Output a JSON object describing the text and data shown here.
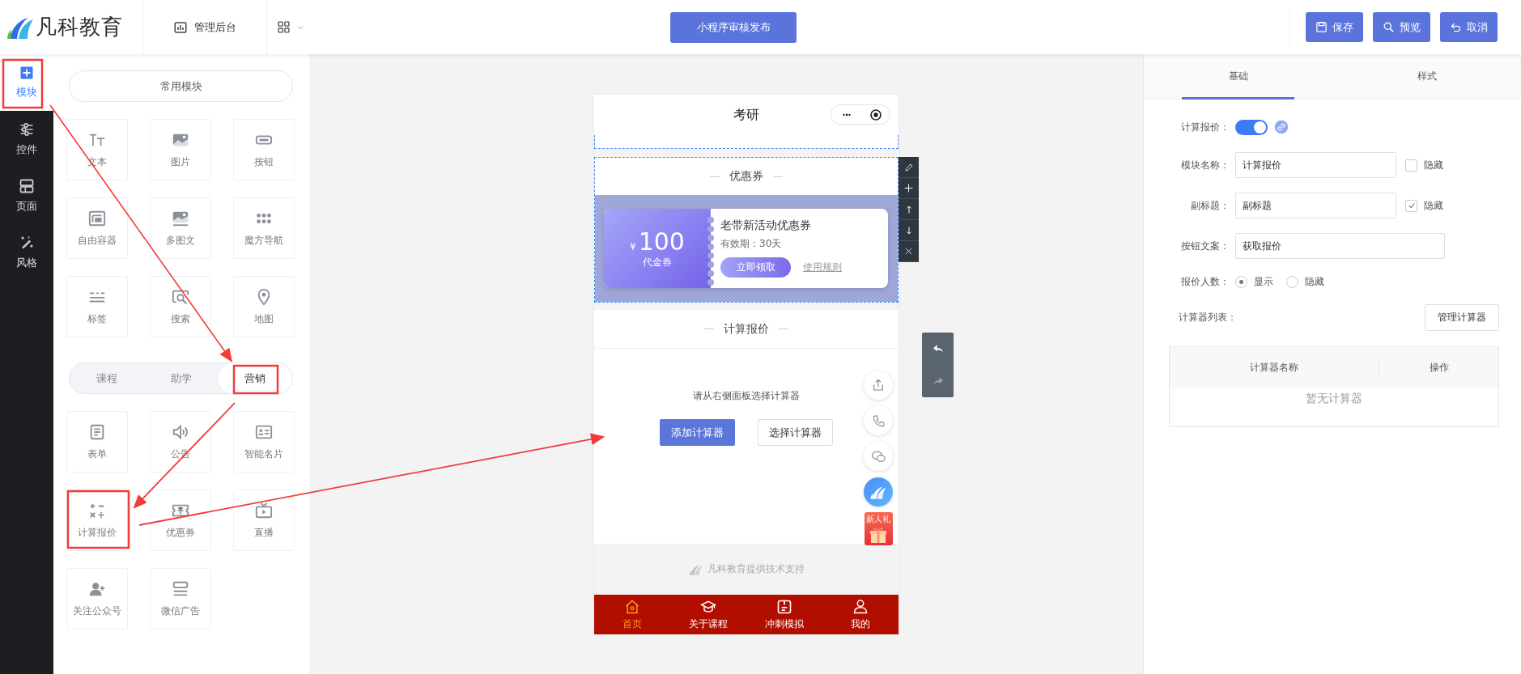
{
  "header": {
    "logo_text": "凡科教育",
    "nav_item": "管理后台",
    "publish_button": "小程序审核发布",
    "actions": [
      {
        "label": "保存"
      },
      {
        "label": "预览"
      },
      {
        "label": "取消"
      }
    ]
  },
  "sidebar": {
    "items": [
      {
        "label": "模块",
        "selected": true
      },
      {
        "label": "控件",
        "selected": false
      },
      {
        "label": "页面",
        "selected": false
      },
      {
        "label": "风格",
        "selected": false
      }
    ]
  },
  "module_panel": {
    "common_button": "常用模块",
    "common_modules": [
      {
        "label": "文本"
      },
      {
        "label": "图片"
      },
      {
        "label": "按钮"
      },
      {
        "label": "自由容器"
      },
      {
        "label": "多图文"
      },
      {
        "label": "魔方导航"
      },
      {
        "label": "标签"
      },
      {
        "label": "搜索"
      },
      {
        "label": "地图"
      }
    ],
    "category_tabs": [
      {
        "label": "课程",
        "selected": false
      },
      {
        "label": "助学",
        "selected": false
      },
      {
        "label": "营销",
        "selected": true
      }
    ],
    "category_modules": [
      {
        "label": "表单"
      },
      {
        "label": "公告"
      },
      {
        "label": "智能名片"
      },
      {
        "label": "计算报价"
      },
      {
        "label": "优惠券"
      },
      {
        "label": "直播"
      },
      {
        "label": "关注公众号"
      },
      {
        "label": "微信广告"
      }
    ]
  },
  "phone": {
    "title": "考研",
    "coupon_section": {
      "title": "优惠券",
      "currency": "¥",
      "amount": "100",
      "kind_label": "代金券",
      "name": "老带新活动优惠券",
      "validity": "有效期：30天",
      "claim_button": "立即领取",
      "rules_link": "使用规则"
    },
    "calculator_section": {
      "title": "计算报价",
      "hint": "请从右侧面板选择计算器",
      "buttons": [
        {
          "label": "添加计算器",
          "kind": "primary"
        },
        {
          "label": "选择计算器",
          "kind": "default"
        }
      ]
    },
    "gift_badge": "新人礼",
    "footer": "凡科教育提供技术支持",
    "tabbar": [
      {
        "label": "首页",
        "selected": true
      },
      {
        "label": "关于课程",
        "selected": false
      },
      {
        "label": "冲刺模拟",
        "selected": false
      },
      {
        "label": "我的",
        "selected": false
      }
    ]
  },
  "settings": {
    "tabs": [
      {
        "label": "基础",
        "selected": true
      },
      {
        "label": "样式",
        "selected": false
      }
    ],
    "form": {
      "toggle": {
        "label": "计算报价：",
        "on": true
      },
      "fields": [
        {
          "label": "模块名称：",
          "value": "计算报价",
          "hide_label": "隐藏",
          "hidden": false
        },
        {
          "label": "副标题：",
          "value": "副标题",
          "hide_label": "隐藏",
          "hidden": true
        },
        {
          "label": "按钮文案：",
          "value": "获取报价"
        }
      ],
      "count_row": {
        "label": "报价人数：",
        "options": [
          {
            "label": "显示",
            "selected": true
          },
          {
            "label": "隐藏",
            "selected": false
          }
        ]
      },
      "list_label": "计算器列表：",
      "manage_button": "管理计算器",
      "table": {
        "columns": [
          "计算器名称",
          "操作"
        ],
        "empty_text": "暂无计算器"
      }
    }
  }
}
